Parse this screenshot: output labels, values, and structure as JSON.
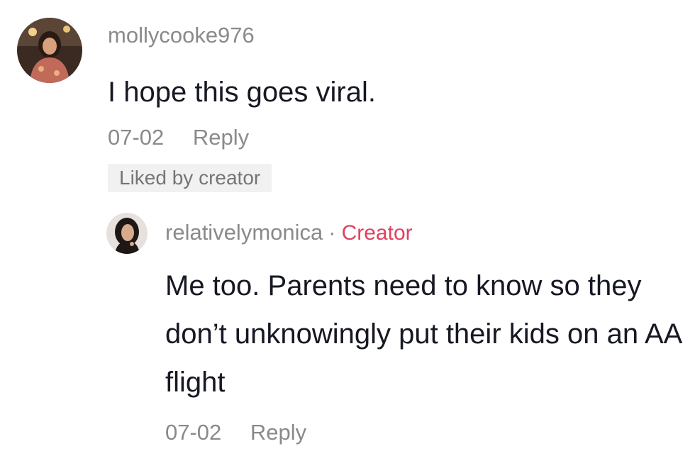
{
  "comment": {
    "username": "mollycooke976",
    "text": "I hope this goes viral.",
    "date": "07-02",
    "reply_label": "Reply",
    "liked_badge": "Liked by creator",
    "avatar_icon": "user-avatar-icon"
  },
  "reply": {
    "username": "relativelymonica",
    "separator": "·",
    "role_badge": "Creator",
    "text": "Me too. Parents need to know so they don’t unknowingly put their kids on an AA flight",
    "date": "07-02",
    "reply_label": "Reply",
    "avatar_icon": "creator-avatar-icon"
  },
  "colors": {
    "muted_text": "#8a8a8a",
    "body_text": "#161823",
    "creator_accent": "#e0425c",
    "badge_background": "#f1f1f2"
  }
}
